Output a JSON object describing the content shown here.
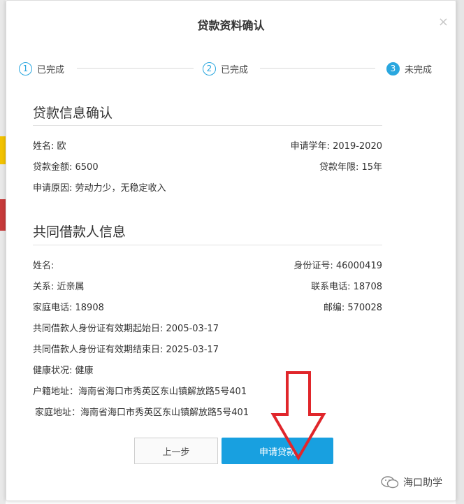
{
  "modal": {
    "title": "贷款资料确认",
    "close_symbol": "×"
  },
  "steps": [
    {
      "number": "1",
      "label": "已完成"
    },
    {
      "number": "2",
      "label": "已完成"
    },
    {
      "number": "3",
      "label": "未完成"
    }
  ],
  "loan_info": {
    "title": "贷款信息确认",
    "name": "姓名: 欧",
    "school_year": "申请学年: 2019-2020",
    "amount": "贷款金额: 6500",
    "term": "贷款年限: 15年",
    "reason": "申请原因: 劳动力少，无稳定收入"
  },
  "co_borrower": {
    "title": "共同借款人信息",
    "name_label": "姓名:",
    "id_number": "身份证号: 46000419",
    "relation": "关系: 近亲属",
    "phone": "联系电话: 18708",
    "home_phone": "家庭电话: 18908",
    "postcode": "邮编: 570028",
    "id_start": "共同借款人身份证有效期起始日: 2005-03-17",
    "id_end": "共同借款人身份证有效期结束日: 2025-03-17",
    "health": "健康状况: 健康",
    "household_address": "户籍地址：海南省海口市秀英区东山镇解放路5号401",
    "home_address": "家庭地址：海南省海口市秀英区东山镇解放路5号401"
  },
  "buttons": {
    "prev": "上一步",
    "apply": "申请贷款"
  },
  "watermark": {
    "text": "海口助学"
  },
  "colors": {
    "accent": "#18a0e0",
    "arrow": "#e0262b"
  }
}
